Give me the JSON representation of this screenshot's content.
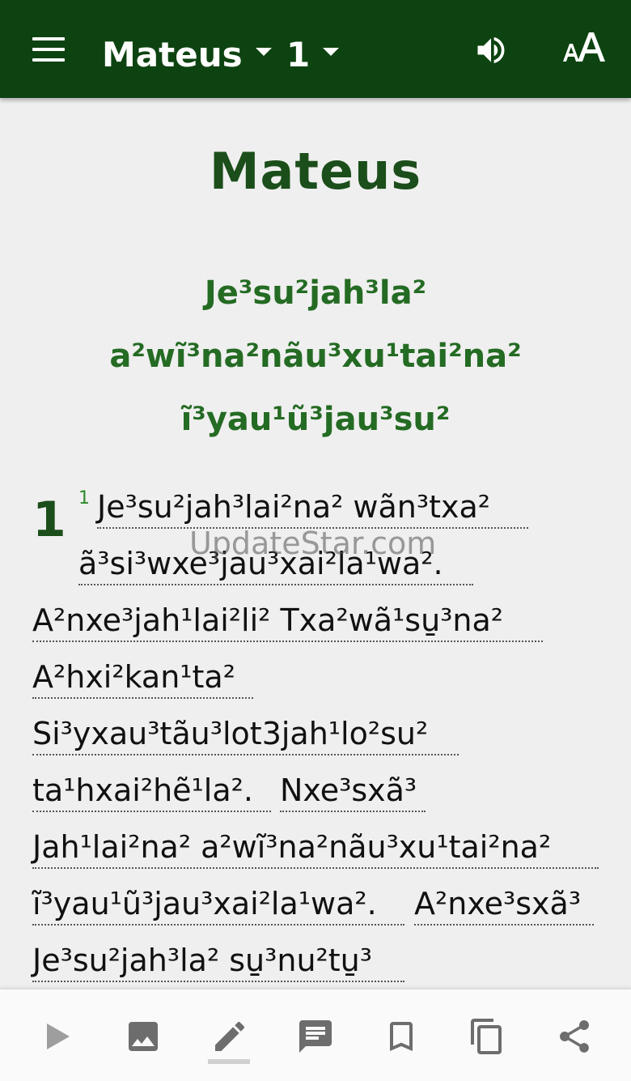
{
  "toolbar": {
    "book": "Mateus",
    "chapter": "1",
    "menu_icon": "hamburger-menu-icon",
    "audio_icon": "speaker-icon",
    "text_size_icon": "text-size-icon"
  },
  "main": {
    "book_title": "Mateus",
    "section_heading": [
      "Je³su²jah³la²",
      "a²wĩ³na²nãu³xu¹tai²na²",
      "ĩ³yau¹ũ³jau³su²"
    ],
    "chapter_number": "1",
    "verse_number": "1",
    "lines": [
      "Je³su²jah³lai²na² wãn³txa²",
      "ã³si³wxe³jau³xai²la¹wa².",
      "A²nxe³jah¹lai²li² Txa²wã¹su̱³na²",
      "A²hxi²kan¹ta²",
      "Si³yxau³tãu³lot3jah¹lo²su²",
      "ta¹hxai²hẽ¹la².",
      "Nxe³sxã³",
      "Jah¹lai²na² a²wĩ³na²nãu³xu¹tai²na²",
      "ĩ³yau¹ũ³jau³xai²la¹wa².",
      "A²nxe³sxã³",
      "Je³su²jah³la² su̱³nu²tu̱³"
    ],
    "watermark": "UpdateStar.com"
  },
  "bottom_nav": {
    "icons": [
      "play-icon",
      "image-icon",
      "edit-icon",
      "comment-icon",
      "bookmark-icon",
      "copy-icon",
      "share-icon"
    ]
  },
  "colors": {
    "appbar": "#0d4311",
    "title": "#1b4e1a",
    "heading": "#246b23",
    "verse_number": "#2c8a2c",
    "icon_gray": "#6d6d6d"
  }
}
